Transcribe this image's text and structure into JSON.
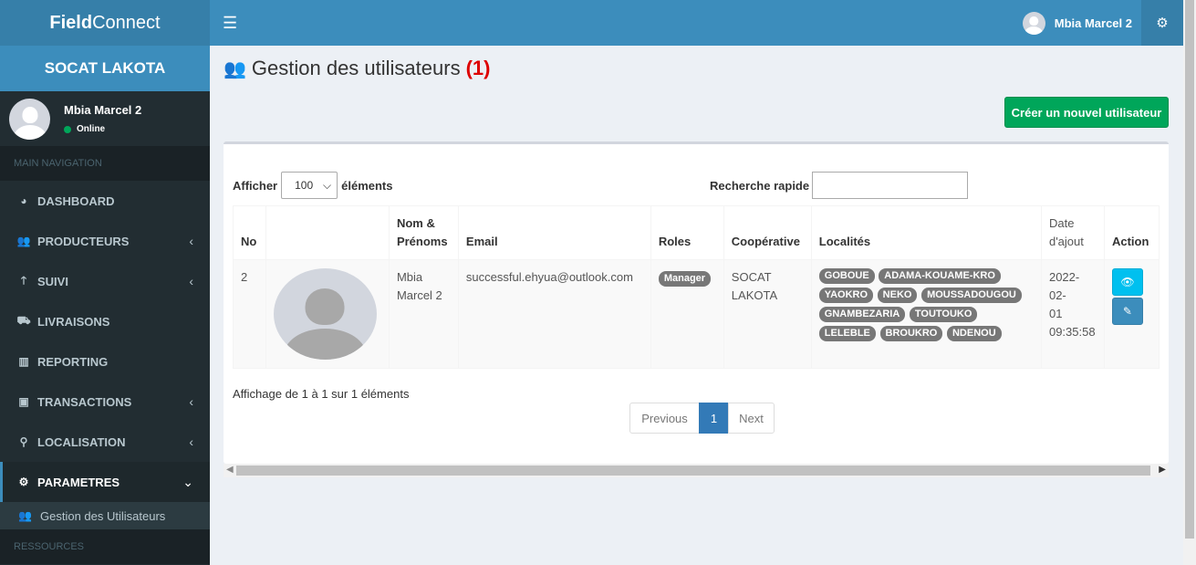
{
  "app": {
    "logo_bold": "Field",
    "logo_rest": "Connect",
    "org": "SOCAT LAKOTA"
  },
  "user": {
    "name": "Mbia Marcel 2",
    "status": "Online"
  },
  "sidebar": {
    "header": "MAIN NAVIGATION",
    "items": [
      {
        "label": "DASHBOARD",
        "icon": "dashboard-icon"
      },
      {
        "label": "PRODUCTEURS",
        "icon": "users-icon"
      },
      {
        "label": "SUIVI",
        "icon": "arrow-up-icon"
      },
      {
        "label": "LIVRAISONS",
        "icon": "delivery-icon"
      },
      {
        "label": "REPORTING",
        "icon": "bar-chart-icon"
      },
      {
        "label": "TRANSACTIONS",
        "icon": "briefcase-icon"
      },
      {
        "label": "LOCALISATION",
        "icon": "map-marker-icon"
      },
      {
        "label": "PARAMETRES",
        "icon": "cogs-icon"
      }
    ],
    "subitem": "Gestion des Utilisateurs",
    "header2": "RESSOURCES"
  },
  "page": {
    "title": "Gestion des utilisateurs",
    "count": "(1)",
    "create_button": "Créer un nouvel utilisateur"
  },
  "table_controls": {
    "show_label": "Afficher",
    "page_size": "100",
    "elements_label": "éléments",
    "search_label": "Recherche rapide"
  },
  "table": {
    "headers": [
      "No",
      "",
      "Nom & Prénoms",
      "Email",
      "Roles",
      "Coopérative",
      "Localités",
      "Date d'ajout",
      "Action"
    ],
    "row": {
      "no": "2",
      "name": "Mbia Marcel 2",
      "email": "successful.ehyua@outlook.com",
      "role": "Manager",
      "cooperative": "SOCAT LAKOTA",
      "localites": [
        "GOBOUE",
        "ADAMA-KOUAME-KRO",
        "YAOKRO",
        "NEKO",
        "MOUSSADOUGOU",
        "GNAMBEZARIA",
        "TOUTOUKO",
        "LELEBLE",
        "BROUKRO",
        "NDENOU"
      ],
      "date_line1": "2022-02-",
      "date_line2": "01",
      "date_line3": "09:35:58"
    }
  },
  "footer": {
    "info": "Affichage de 1 à 1 sur 1 éléments",
    "prev": "Previous",
    "page": "1",
    "next": "Next"
  }
}
